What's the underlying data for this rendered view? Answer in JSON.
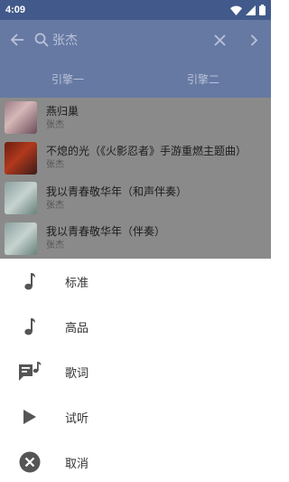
{
  "status_bar": {
    "time": "4:09"
  },
  "toolbar": {
    "search_text": "张杰"
  },
  "tabs": [
    {
      "label": "引擎一"
    },
    {
      "label": "引擎二"
    }
  ],
  "songs": [
    {
      "title": "燕归巢",
      "artist": "张杰"
    },
    {
      "title": "不熄的光（《火影忍者》手游重燃主题曲）",
      "artist": "张杰"
    },
    {
      "title": "我以青春敬华年（和声伴奏）",
      "artist": "张杰"
    },
    {
      "title": "我以青春敬华年（伴奏）",
      "artist": "张杰"
    }
  ],
  "menu": [
    {
      "label": "标准",
      "icon": "music-note-icon"
    },
    {
      "label": "高品",
      "icon": "music-note-icon"
    },
    {
      "label": "歌词",
      "icon": "lyrics-icon"
    },
    {
      "label": "试听",
      "icon": "play-icon"
    },
    {
      "label": "取消",
      "icon": "close-circle-icon"
    }
  ],
  "colors": {
    "status_bar": "#415a8b",
    "toolbar": "#6679a3",
    "dim_text": "#b9c3d9",
    "icon_gray": "#555555"
  }
}
